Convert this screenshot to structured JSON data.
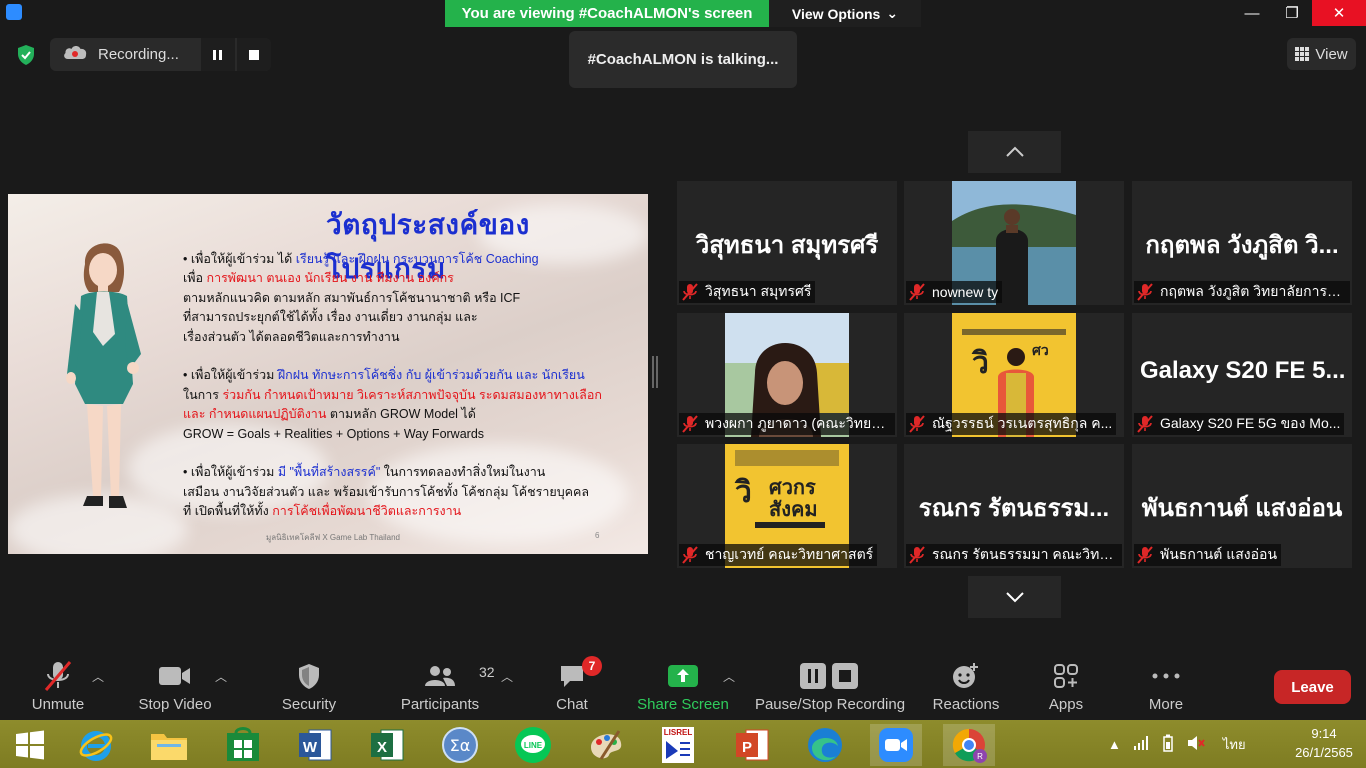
{
  "banner": {
    "viewing": "You are viewing #CoachALMON's screen",
    "options": "View Options"
  },
  "recording": {
    "label": "Recording..."
  },
  "talking": "#CoachALMON is talking...",
  "view_button": "View",
  "slide": {
    "title": "วัตถุประสงค์ของโปรแกรม",
    "b1": {
      "l1a": "• เพื่อให้ผู้เข้าร่วม ได้ ",
      "l1b": "เรียนรู้ และ ฝึกฝน กระบวนการโค้ช Coaching",
      "l2a": "เพื่อ ",
      "l2b": "การพัฒนา ตนเอง นักเรียน งาน ทีมงาน องค์กร",
      "l3": "ตามหลักแนวคิด ตามหลัก สมาพันธ์การโค้ชนานาชาติ หรือ ICF",
      "l4": "ที่สามารถประยุกต์ใช้ได้ทั้ง เรื่อง งานเดี่ยว งานกลุ่ม และ",
      "l5": "เรื่องส่วนตัว ได้ตลอดชีวิตและการทำงาน"
    },
    "b2": {
      "l1a": "• เพื่อให้ผู้เข้าร่วม ",
      "l1b": "ฝึกฝน ทักษะการโค้ชชิ่ง กับ ผู้เข้าร่วมด้วยกัน และ นักเรียน",
      "l2a": "ในการ ",
      "l2b": "ร่วมกัน กำหนดเป้าหมาย วิเคราะห์สภาพปัจจุบัน ระดมสมองหาทางเลือก",
      "l3a": "และ กำหนดแผนปฏิบัติงาน",
      "l3b": " ตามหลัก GROW Model ได้",
      "l4": "GROW = Goals + Realities + Options + Way Forwards"
    },
    "b3": {
      "l1a": "• เพื่อให้ผู้เข้าร่วม ",
      "l1b": "มี \"พื้นที่สร้างสรรค์\"",
      "l1c": " ในการทดลองทำสิ่งใหม่ในงาน",
      "l2": "เสมือน งานวิจัยส่วนตัว และ พร้อมเข้ารับการโค้ชทั้ง โค้ชกลุ่ม โค้ชรายบุคคล",
      "l3a": "ที่ เปิดพื้นที่ให้ทั้ง ",
      "l3b": "การโค้ชเพื่อพัฒนาชีวิตและการงาน"
    },
    "footer": "มูลนิธิเทคโคลีฟ X Game Lab Thailand",
    "page": "6"
  },
  "tiles": [
    {
      "big": "วิสุทธนา สมุทรศรี",
      "name": "วิสุทธนา สมุทรศรี"
    },
    {
      "big": "",
      "name": "nownew ty",
      "photo": "lake"
    },
    {
      "big": "กฤตพล วังภูสิต วิ...",
      "name": "กฤตพล วังภูสิต วิทยาลัยการฝึ..."
    },
    {
      "big": "",
      "name": "พวงผกา ภูยาดาว (คณะวิทยาศ...",
      "photo": "woman"
    },
    {
      "big": "",
      "name": "ณัฐวรรธน์ วรเนตรสุทธิกุล ค...",
      "photo": "poster-man"
    },
    {
      "big": "Galaxy S20 FE 5...",
      "name": "Galaxy S20 FE 5G ของ Mo..."
    },
    {
      "big": "",
      "name": "ชาญเวทย์ คณะวิทยาศาสตร์",
      "photo": "poster"
    },
    {
      "big": "รณกร รัตนธรรม...",
      "name": "รณกร รัตนธรรมมา คณะวิทยา..."
    },
    {
      "big": "พันธกานต์ แสงอ่อน",
      "name": "พันธกานต์ แสงอ่อน"
    }
  ],
  "toolbar": {
    "unmute": "Unmute",
    "stop_video": "Stop Video",
    "security": "Security",
    "participants": "Participants",
    "participants_count": "32",
    "chat": "Chat",
    "chat_badge": "7",
    "share": "Share Screen",
    "pause_stop": "Pause/Stop Recording",
    "reactions": "Reactions",
    "apps": "Apps",
    "more": "More",
    "leave": "Leave"
  },
  "taskbar": {
    "lang": "ไทย",
    "time": "9:14",
    "date": "26/1/2565",
    "lisrel": "LISREL"
  },
  "colors": {
    "share_green": "#24b24b",
    "leave_red": "#c72626",
    "muted_red": "#e02828",
    "taskbar": "#8a8a2a"
  }
}
